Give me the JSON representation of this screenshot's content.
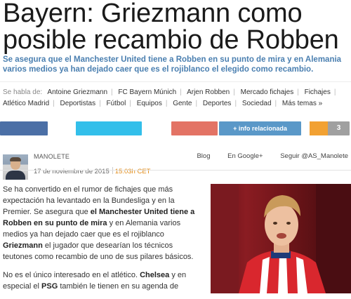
{
  "article": {
    "headline": "Bayern: Griezmann como posible recambio de Robben",
    "subheadline": "Se asegura que el Manchester United tiene a Robben en su punto de mira y en Alemania varios medios ya han dejado caer que es el rojiblanco el elegido como recambio."
  },
  "tags": {
    "lead": "Se habla de:",
    "items": [
      "Antoine Griezmann",
      "FC Bayern Múnich",
      "Arjen Robben",
      "Mercado fichajes",
      "Fichajes",
      "Atlético Madrid",
      "Deportistas",
      "Fútbol",
      "Equipos",
      "Gente",
      "Deportes",
      "Sociedad"
    ],
    "more": "Más temas »"
  },
  "share": {
    "info_label": "+ info relacionada",
    "count": "3",
    "colors": {
      "facebook": "#4b6fa6",
      "twitter": "#33bfea",
      "googleplus": "#e37365",
      "info": "#5a98c8",
      "count_accent": "#f2a132"
    }
  },
  "author": {
    "name": "MANOLETE",
    "date": "17 de noviembre de 2015",
    "time": "15:03h CET",
    "links": [
      "Blog",
      "En Google+",
      "Seguir @AS_Manolete"
    ]
  },
  "body": {
    "p1": {
      "a": "Se ha convertido en el rumor de fichajes que más expectación ha levantado en la Bundesliga y en la Premier. Se asegura que ",
      "b": "el Manchester United tiene a Robben en su punto de mira",
      "c": " y en Alemania varios medios ya han dejado caer que es el rojiblanco ",
      "d": "Griezmann",
      "e": " el jugador que desearían los técnicos teutones como recambio de uno de sus pilares básicos."
    },
    "p2": {
      "a": "No es el único interesado en el atlético. ",
      "b": "Chelsea",
      "c": " y en especial el ",
      "d": "PSG",
      "e": " también le tienen en su agenda de"
    }
  }
}
